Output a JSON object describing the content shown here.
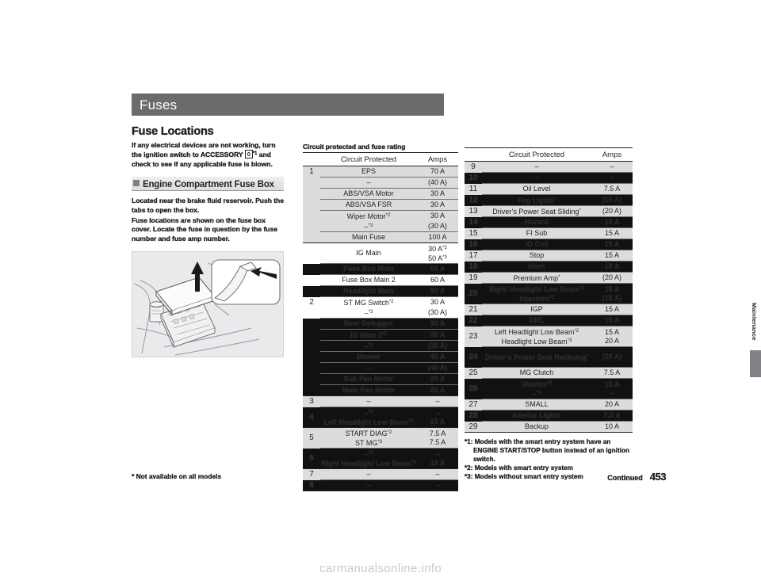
{
  "page": {
    "section_title": "Fuses",
    "heading": "Fuse Locations",
    "intro_before_key": "If any electrical devices are not working, turn the ignition switch to ACCESSORY ",
    "intro_key": "0",
    "intro_key_sup": "*1",
    "intro_after_key": " and check to see if any applicable fuse is blown.",
    "subhead": "Engine Compartment Fuse Box",
    "body_paragraph_1": "Located near the brake fluid reservoir. Push the tabs to open the box.",
    "body_paragraph_2": "Fuse locations are shown on the fuse box cover. Locate the fuse in question by the fuse number and fuse amp number.",
    "illustration_name": "engine-compartment-fuse-box-illustration",
    "edge_tab_label": "Maintenance",
    "footer_left": "* Not available on all models",
    "footer_continued": "Continued",
    "footer_page_number": "453",
    "watermark": "carmanualsonline.info"
  },
  "table": {
    "note": "Circuit protected and fuse rating",
    "columns": [
      "",
      "Circuit Protected",
      "Amps"
    ],
    "left": [
      {
        "num": "1",
        "group_start": true,
        "shade": true,
        "redact": false,
        "circuit": "EPS",
        "amps": "70 A"
      },
      {
        "num": "",
        "group_start": false,
        "shade": true,
        "redact": false,
        "circuit": "–",
        "amps": "(40 A)"
      },
      {
        "num": "",
        "group_start": false,
        "shade": true,
        "redact": false,
        "circuit": "ABS/VSA Motor",
        "amps": "30 A"
      },
      {
        "num": "",
        "group_start": false,
        "shade": true,
        "redact": false,
        "circuit": "ABS/VSA FSR",
        "amps": "30 A"
      },
      {
        "num": "",
        "group_start": false,
        "shade": true,
        "redact": false,
        "circuit": "Wiper Motor*2",
        "amps": "30 A"
      },
      {
        "num": "",
        "group_start": false,
        "shade": true,
        "redact": false,
        "circuit": "–*3",
        "amps": "(30 A)",
        "nosep": true
      },
      {
        "num": "",
        "group_start": false,
        "shade": true,
        "redact": false,
        "circuit": "Main Fuse",
        "amps": "100 A"
      },
      {
        "num": "",
        "group_start": true,
        "shade": false,
        "redact": false,
        "circuit": "IG Main",
        "amps": "30 A*2 / 50 A*3",
        "tall": true
      },
      {
        "num": "",
        "group_start": false,
        "shade": false,
        "redact": true,
        "circuit": "Fuse Box Main",
        "amps": "60 A"
      },
      {
        "num": "",
        "group_start": false,
        "shade": false,
        "redact": false,
        "circuit": "Fuse Box Main 2",
        "amps": "60 A"
      },
      {
        "num": "",
        "group_start": false,
        "shade": false,
        "redact": true,
        "circuit": "Headlight Main",
        "amps": "30 A"
      },
      {
        "num": "2",
        "group_start": false,
        "shade": false,
        "redact": false,
        "circuit": "ST MG Switch*2",
        "amps": "30 A"
      },
      {
        "num": "",
        "group_start": false,
        "shade": false,
        "redact": false,
        "circuit": "–*3",
        "amps": "(30 A)",
        "nosep": true
      },
      {
        "num": "",
        "group_start": false,
        "shade": false,
        "redact": true,
        "circuit": "Rear Defogger",
        "amps": "30 A"
      },
      {
        "num": "",
        "group_start": false,
        "shade": false,
        "redact": true,
        "circuit": "IG Main 2*2",
        "amps": "30 A"
      },
      {
        "num": "",
        "group_start": false,
        "shade": false,
        "redact": true,
        "circuit": "–*3",
        "amps": "(30 A)"
      },
      {
        "num": "",
        "group_start": false,
        "shade": false,
        "redact": true,
        "circuit": "Blower",
        "amps": "40 A"
      },
      {
        "num": "",
        "group_start": false,
        "shade": false,
        "redact": true,
        "circuit": "–",
        "amps": "(40 A)"
      },
      {
        "num": "",
        "group_start": false,
        "shade": false,
        "redact": true,
        "circuit": "Sub Fan Motor",
        "amps": "20 A"
      },
      {
        "num": "",
        "group_start": false,
        "shade": false,
        "redact": true,
        "circuit": "Main Fan Motor",
        "amps": "20 A"
      },
      {
        "num": "3",
        "group_start": true,
        "shade": true,
        "redact": false,
        "circuit": "–",
        "amps": "–"
      },
      {
        "num": "4",
        "group_start": false,
        "shade": false,
        "redact": true,
        "circuit": "Left Headlight Low Beam*3",
        "amps": "15 A",
        "pre": "–*2"
      },
      {
        "num": "5",
        "group_start": true,
        "shade": true,
        "redact": false,
        "circuit": "START DIAG*2 / ST MG*3",
        "amps": "7.5 A / 7.5 A",
        "tall": true
      },
      {
        "num": "6",
        "group_start": false,
        "shade": false,
        "redact": true,
        "circuit": "Right Headlight Low Beam*3",
        "amps": "15 A",
        "pre": "–*2"
      },
      {
        "num": "7",
        "group_start": true,
        "shade": true,
        "redact": false,
        "circuit": "–",
        "amps": "–"
      },
      {
        "num": "8",
        "group_start": false,
        "shade": false,
        "redact": true,
        "circuit": "–",
        "amps": "–"
      }
    ],
    "right": [
      {
        "num": "9",
        "shade": true,
        "redact": false,
        "circuit": "–",
        "amps": "–"
      },
      {
        "num": "10",
        "shade": false,
        "redact": true,
        "circuit": "–",
        "amps": "–"
      },
      {
        "num": "11",
        "shade": true,
        "redact": false,
        "circuit": "Oil Level",
        "amps": "7.5 A"
      },
      {
        "num": "12",
        "shade": false,
        "redact": true,
        "circuit": "Fog Lights*",
        "amps": "(15 A)"
      },
      {
        "num": "13",
        "shade": true,
        "redact": false,
        "circuit": "Driver’s Power Seat Sliding*",
        "amps": "(20 A)"
      },
      {
        "num": "14",
        "shade": false,
        "redact": true,
        "circuit": "Hazard",
        "amps": "10 A"
      },
      {
        "num": "15",
        "shade": true,
        "redact": false,
        "circuit": "FI Sub",
        "amps": "15 A"
      },
      {
        "num": "16",
        "shade": false,
        "redact": true,
        "circuit": "IG Coil",
        "amps": "15 A"
      },
      {
        "num": "17",
        "shade": true,
        "redact": false,
        "circuit": "Stop",
        "amps": "15 A"
      },
      {
        "num": "18",
        "shade": false,
        "redact": true,
        "circuit": "Horn",
        "amps": "10 A"
      },
      {
        "num": "19",
        "shade": true,
        "redact": false,
        "circuit": "Premium Amp*",
        "amps": "(20 A)"
      },
      {
        "num": "20",
        "shade": false,
        "redact": true,
        "circuit": "Right Headlight Low Beam*2 / Injectors*3",
        "amps": "15 A / (15 A)",
        "tall": true
      },
      {
        "num": "21",
        "shade": true,
        "redact": false,
        "circuit": "IGP",
        "amps": "15 A"
      },
      {
        "num": "22",
        "shade": false,
        "redact": true,
        "circuit": "DRL",
        "amps": "15 A"
      },
      {
        "num": "23",
        "shade": true,
        "redact": false,
        "circuit": "Left Headlight Low Beam*2 / Headlight Low Beam*3",
        "amps": "15 A / 20 A",
        "tall": true
      },
      {
        "num": "24",
        "shade": false,
        "redact": true,
        "circuit": "Driver’s Power Seat Reclining*",
        "amps": "(20 A)",
        "tall": true
      },
      {
        "num": "25",
        "shade": true,
        "redact": false,
        "circuit": "MG Clutch",
        "amps": "7.5 A"
      },
      {
        "num": "26",
        "shade": false,
        "redact": true,
        "circuit": "Washer*2 / –*3",
        "amps": "15 A / –",
        "tall": true
      },
      {
        "num": "27",
        "shade": true,
        "redact": false,
        "circuit": "SMALL",
        "amps": "20 A"
      },
      {
        "num": "28",
        "shade": false,
        "redact": true,
        "circuit": "Interior Lights",
        "amps": "7.5 A"
      },
      {
        "num": "29",
        "shade": true,
        "redact": false,
        "circuit": "Backup",
        "amps": "10 A"
      }
    ],
    "footnotes": [
      "*1: Models with the smart entry system have an ENGINE START/STOP button instead of an ignition switch.",
      "*2: Models with smart entry system",
      "*3: Models without smart entry system"
    ]
  }
}
